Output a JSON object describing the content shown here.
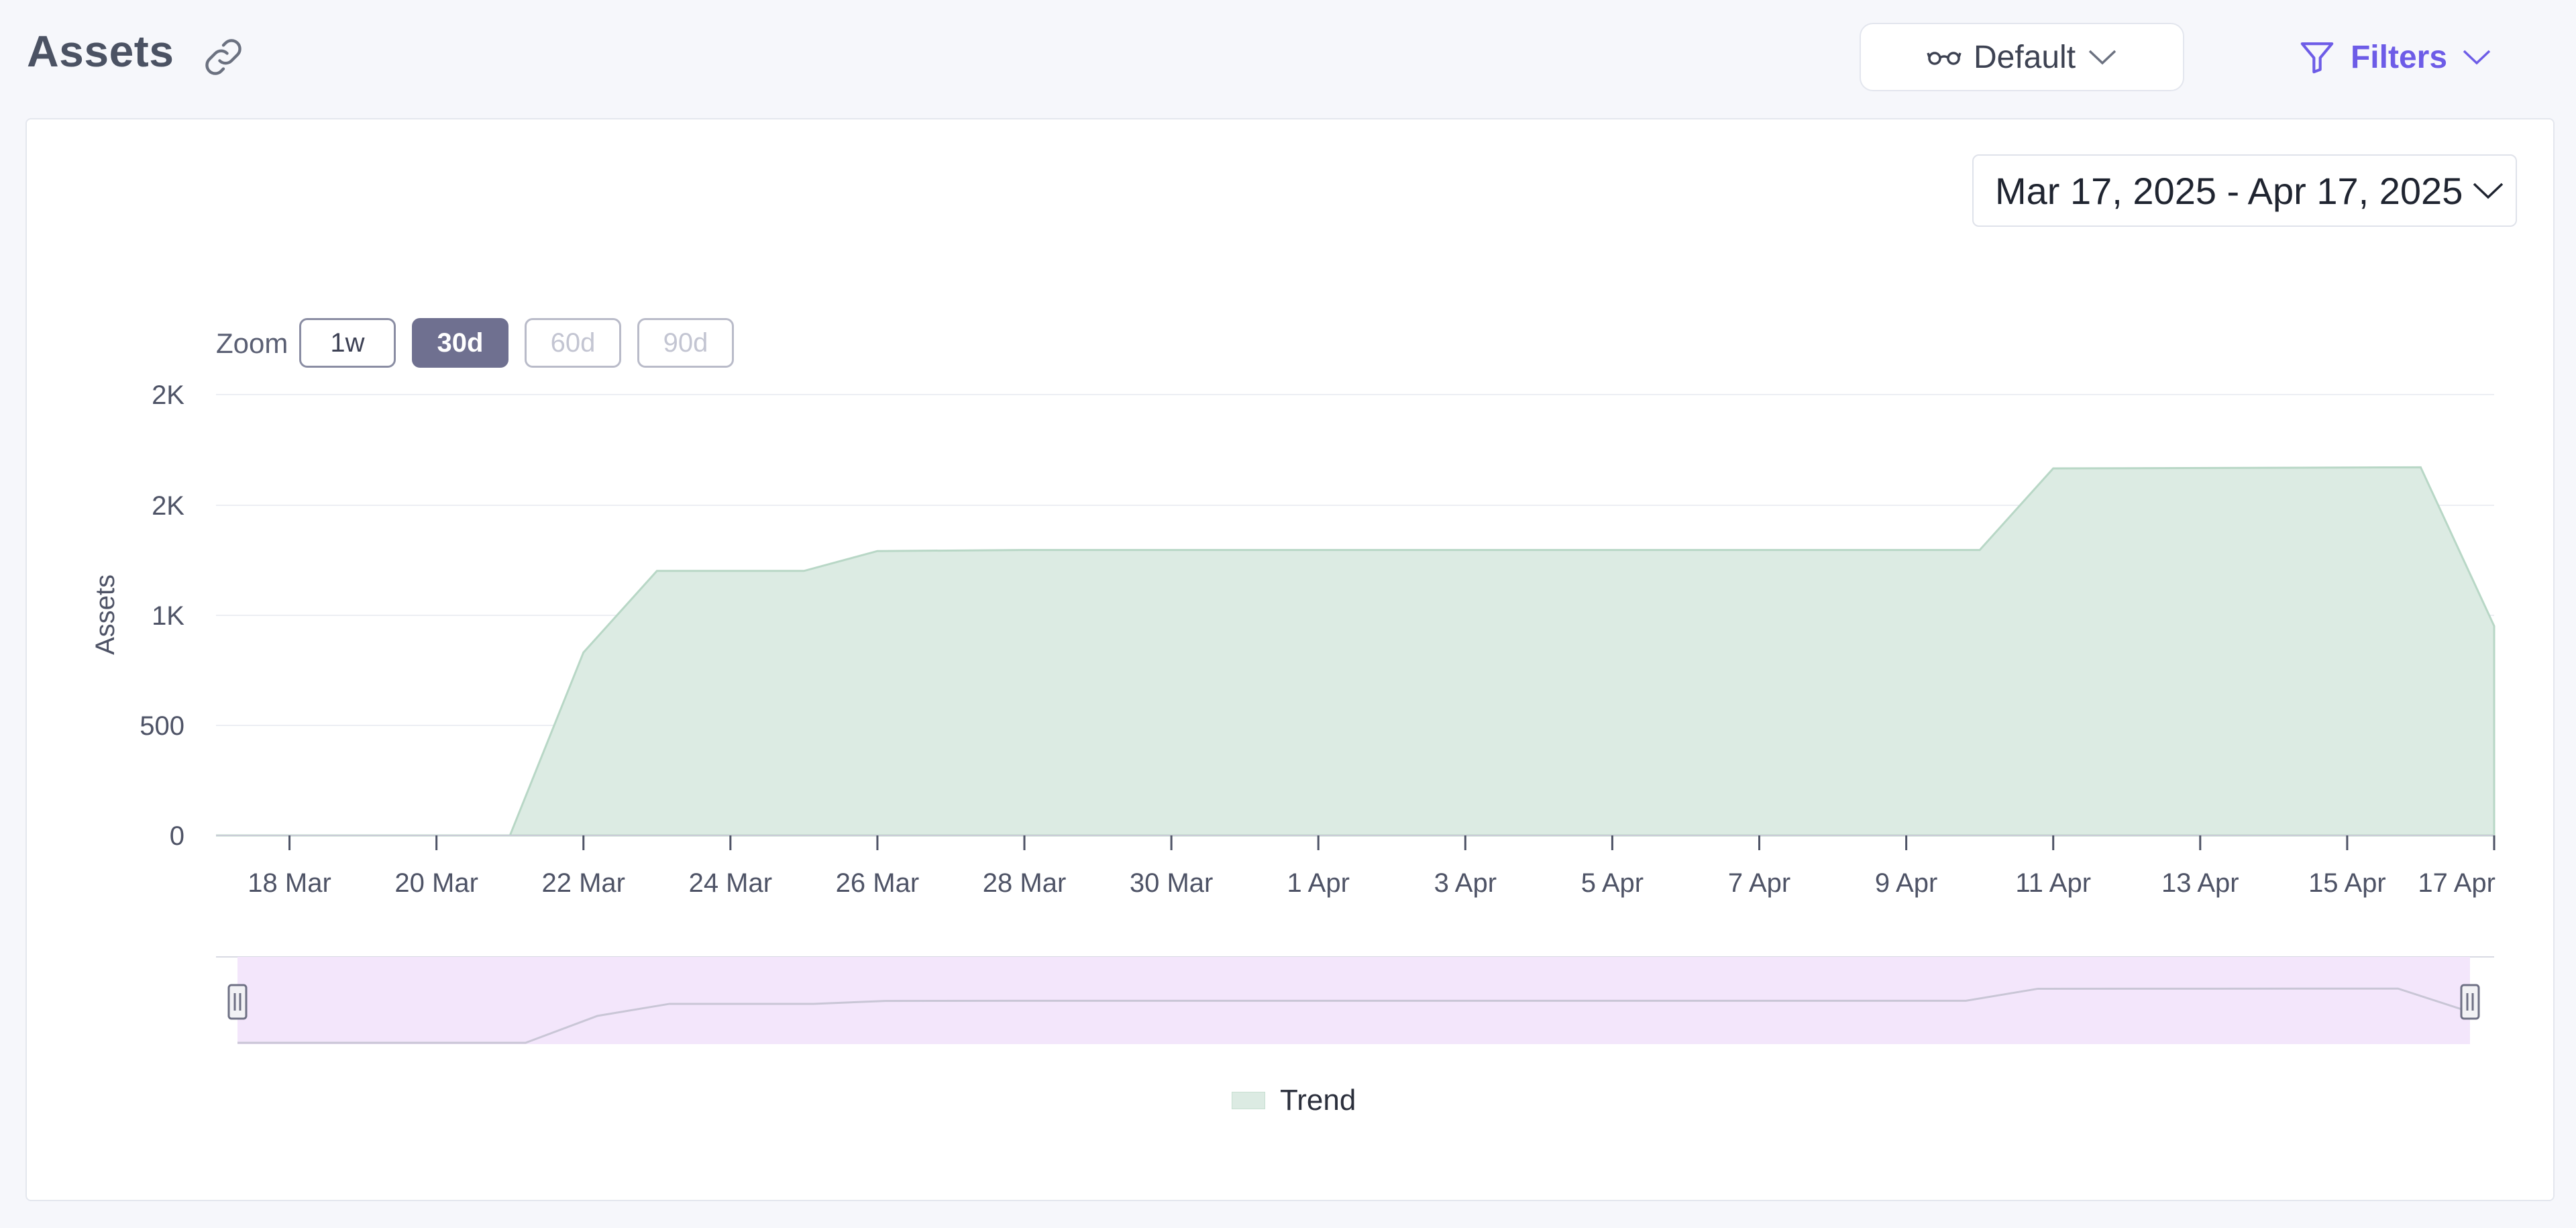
{
  "header": {
    "title": "Assets",
    "view_select": "Default",
    "filters_label": "Filters"
  },
  "date_range": "Mar 17, 2025 - Apr 17, 2025",
  "zoom": {
    "label": "Zoom",
    "options": [
      "1w",
      "30d",
      "60d",
      "90d"
    ],
    "active": "30d",
    "disabled": [
      "60d",
      "90d"
    ]
  },
  "colors": {
    "area_fill": "#dcebe3",
    "area_stroke": "#b8d7c6",
    "navigator_fill": "#f3e6fb",
    "accent": "#6d5ce7"
  },
  "chart_data": {
    "type": "area",
    "ylabel": "Assets",
    "y_ticks": [
      0,
      500,
      1000,
      1500,
      2000
    ],
    "y_tick_labels": [
      "0",
      "500",
      "1K",
      "2K",
      "2K"
    ],
    "ylim": [
      0,
      2000
    ],
    "x_tick_labels": [
      "18 Mar",
      "20 Mar",
      "22 Mar",
      "24 Mar",
      "26 Mar",
      "28 Mar",
      "30 Mar",
      "1 Apr",
      "3 Apr",
      "5 Apr",
      "7 Apr",
      "9 Apr",
      "11 Apr",
      "13 Apr",
      "15 Apr",
      "17 Apr"
    ],
    "x_range": [
      "2025-03-17",
      "2025-04-17"
    ],
    "grid": true,
    "series": [
      {
        "name": "Trend",
        "points": [
          {
            "x": "2025-03-17",
            "y": 0
          },
          {
            "x": "2025-03-20",
            "y": 0
          },
          {
            "x": "2025-03-21",
            "y": 0
          },
          {
            "x": "2025-03-22",
            "y": 830
          },
          {
            "x": "2025-03-23",
            "y": 1200
          },
          {
            "x": "2025-03-24",
            "y": 1200
          },
          {
            "x": "2025-03-25",
            "y": 1200
          },
          {
            "x": "2025-03-26",
            "y": 1290
          },
          {
            "x": "2025-03-28",
            "y": 1295
          },
          {
            "x": "2025-04-10",
            "y": 1295
          },
          {
            "x": "2025-04-11",
            "y": 1665
          },
          {
            "x": "2025-04-16",
            "y": 1670
          },
          {
            "x": "2025-04-17",
            "y": 950
          }
        ]
      }
    ],
    "legend": "bottom-center"
  }
}
